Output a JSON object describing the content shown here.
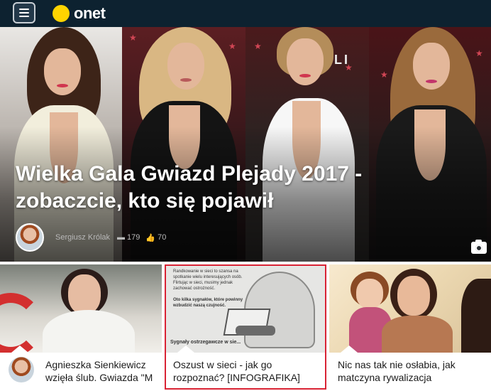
{
  "header": {
    "logo_text": "onet",
    "menu_icon": "hamburger-icon",
    "logo_icon": "yellow-dot-icon"
  },
  "hero": {
    "title": "Wielka Gala Gwiazd Plejady 2017 - zobaczcie, kto się pojawił",
    "author": "Sergiusz Królak",
    "comments_count": "179",
    "likes_count": "70",
    "comment_icon": "comment-icon",
    "like_icon": "thumbs-up-icon",
    "gallery_icon": "camera-icon"
  },
  "cards": [
    {
      "title": "Agnieszka Sienkiewicz wzięła ślub. Gwiazda \"M"
    },
    {
      "title_line1": "Oszust w sieci - jak go",
      "title_line2": "rozpoznać? [INFOGRAFIKA]",
      "infographic_text": "Randkowanie w sieci to szansa na spotkanie wielu interesujących osób. Flirtując w sieci, musimy jednak zachować ostrożność.",
      "infographic_text2": "Oto kilka sygnałów, które powinny wzbudzić naszą czujność.",
      "infographic_sub": "Sygnały ostrzegawcze w sie..."
    },
    {
      "title_line1": "Nic nas tak nie osłabia, jak",
      "title_line2": "matczyna rywalizacja"
    }
  ],
  "colors": {
    "header_bg": "#0d2230",
    "logo_dot": "#ffd400",
    "highlight_border": "#d92334"
  }
}
